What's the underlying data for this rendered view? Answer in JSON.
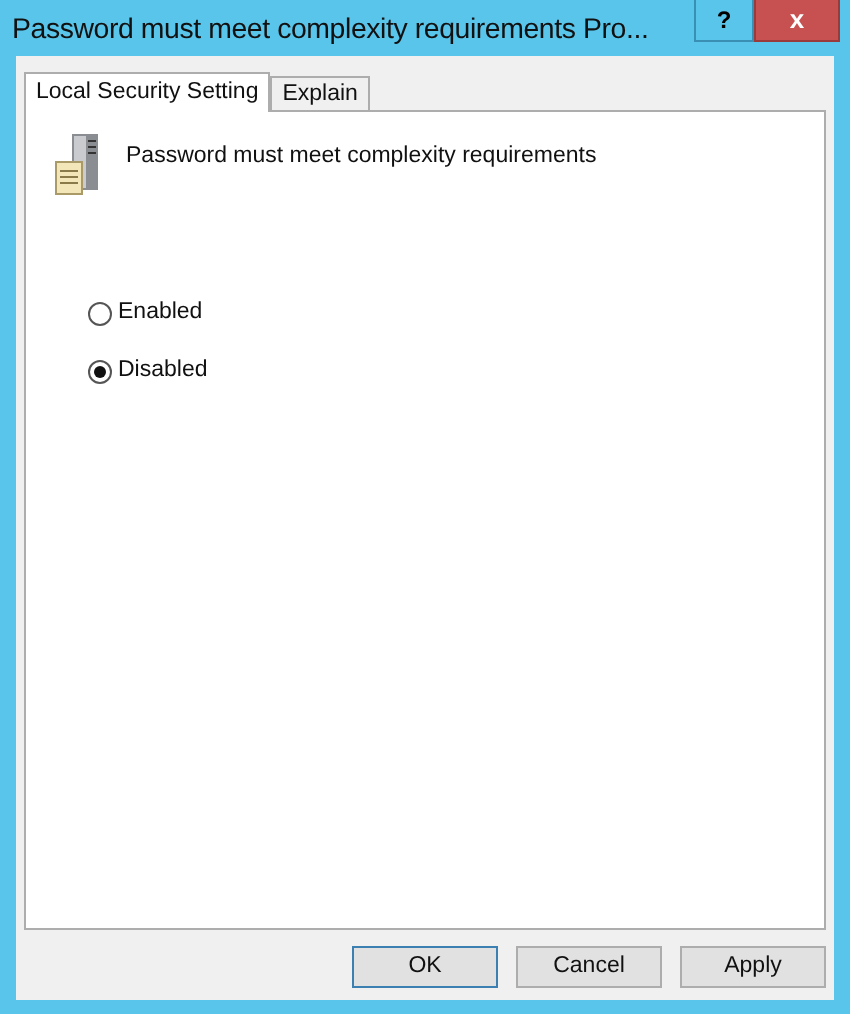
{
  "window": {
    "title": "Password must meet complexity requirements Pro...",
    "help": "?",
    "close": "x"
  },
  "tabs": [
    {
      "label": "Local Security Setting",
      "selected": true
    },
    {
      "label": "Explain",
      "selected": false
    }
  ],
  "policy": {
    "name": "Password must meet complexity requirements"
  },
  "options": [
    {
      "label": "Enabled",
      "selected": false
    },
    {
      "label": "Disabled",
      "selected": true
    }
  ],
  "buttons": [
    {
      "label": "OK",
      "default": true
    },
    {
      "label": "Cancel",
      "default": false
    },
    {
      "label": "Apply",
      "default": false
    }
  ]
}
